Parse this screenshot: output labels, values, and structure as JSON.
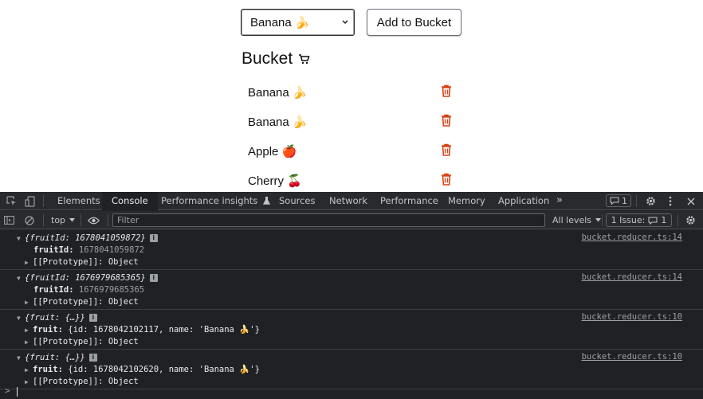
{
  "app": {
    "select_value": "Banana 🍌",
    "add_button": "Add to Bucket",
    "bucket_title": "Bucket",
    "bucket_items": [
      {
        "name": "Banana 🍌"
      },
      {
        "name": "Banana 🍌"
      },
      {
        "name": "Apple 🍎"
      },
      {
        "name": "Cherry 🍒"
      }
    ],
    "trash_color": "#d84315"
  },
  "devtools": {
    "tabs": [
      "Elements",
      "Console",
      "Performance insights",
      "Sources",
      "Network",
      "Performance",
      "Memory",
      "Application"
    ],
    "active_tab": "Console",
    "more_tabs": "»",
    "issues_badge": "1",
    "toolbar": {
      "context": "top",
      "filter_placeholder": "Filter",
      "levels": "All levels",
      "issue_label": "1 Issue:",
      "issue_count": "1"
    },
    "logs": [
      {
        "summary": "{fruitId: 1678041059872}",
        "source": "bucket.reducer.ts:14",
        "prop_key": "fruitId:",
        "prop_value": "1678041059872",
        "proto": "[[Prototype]]: Object"
      },
      {
        "summary": "{fruitId: 1676979685365}",
        "source": "bucket.reducer.ts:14",
        "prop_key": "fruitId:",
        "prop_value": "1676979685365",
        "proto": "[[Prototype]]: Object"
      },
      {
        "summary": "{fruit: {…}}",
        "source": "bucket.reducer.ts:10",
        "prop_key": "fruit:",
        "prop_value": "{id: 1678042102117, name: 'Banana 🍌'}",
        "proto": "[[Prototype]]: Object"
      },
      {
        "summary": "{fruit: {…}}",
        "source": "bucket.reducer.ts:10",
        "prop_key": "fruit:",
        "prop_value": "{id: 1678042102620, name: 'Banana 🍌'}",
        "proto": "[[Prototype]]: Object"
      }
    ],
    "prompt_symbol": ">"
  }
}
